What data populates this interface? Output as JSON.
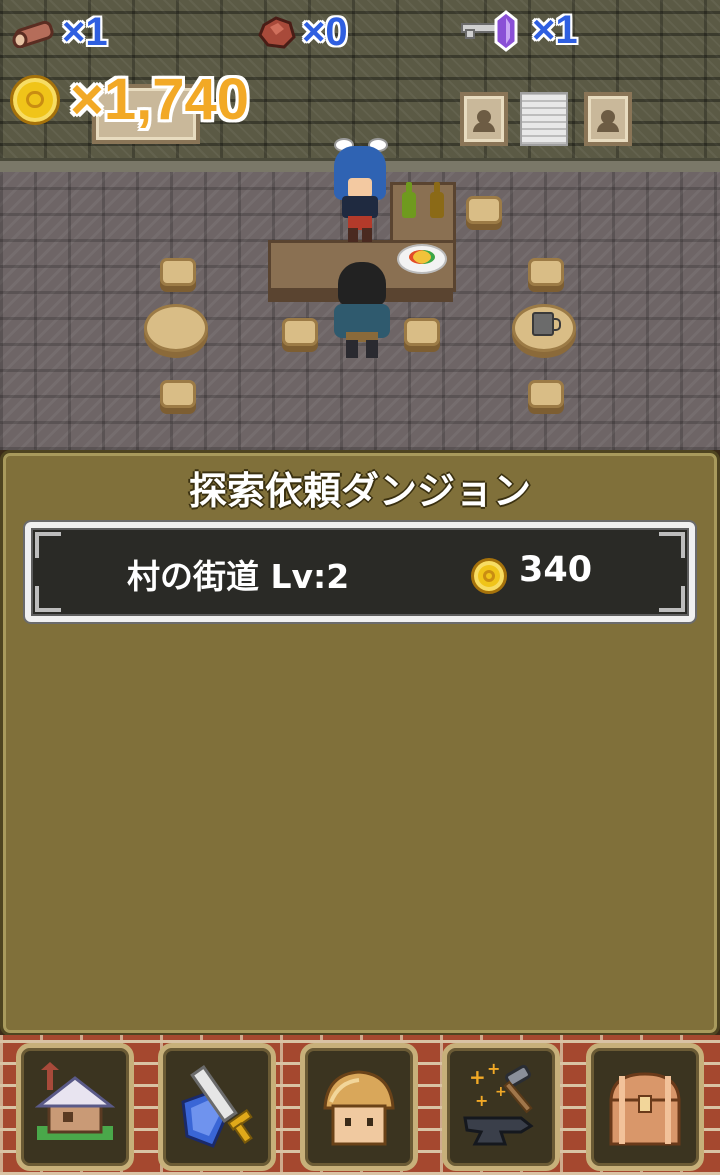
{
  "hud": {
    "wood": {
      "icon": "log-icon",
      "count": "×1"
    },
    "ore": {
      "icon": "ore-icon",
      "count": "×0"
    },
    "crystal": {
      "icon": "crystal-key-icon",
      "count": "×1"
    },
    "gold": {
      "icon": "gold-coin-icon",
      "count": "×1,740"
    }
  },
  "panel": {
    "title": "探索依頼ダンジョン",
    "dungeons": [
      {
        "name": "村の街道  Lv:2",
        "reward": "340"
      }
    ]
  },
  "nav": [
    {
      "name": "village",
      "icon": "house-icon"
    },
    {
      "name": "equipment",
      "icon": "sword-shield-icon"
    },
    {
      "name": "shop",
      "icon": "bread-icon"
    },
    {
      "name": "forge",
      "icon": "anvil-hammer-icon"
    },
    {
      "name": "storage",
      "icon": "treasure-chest-icon"
    }
  ],
  "colors": {
    "panel_bg": "#80703a",
    "gold_text": "#f2a926",
    "count_text": "#2f5fe0",
    "nav_brick": "#a5482f"
  }
}
